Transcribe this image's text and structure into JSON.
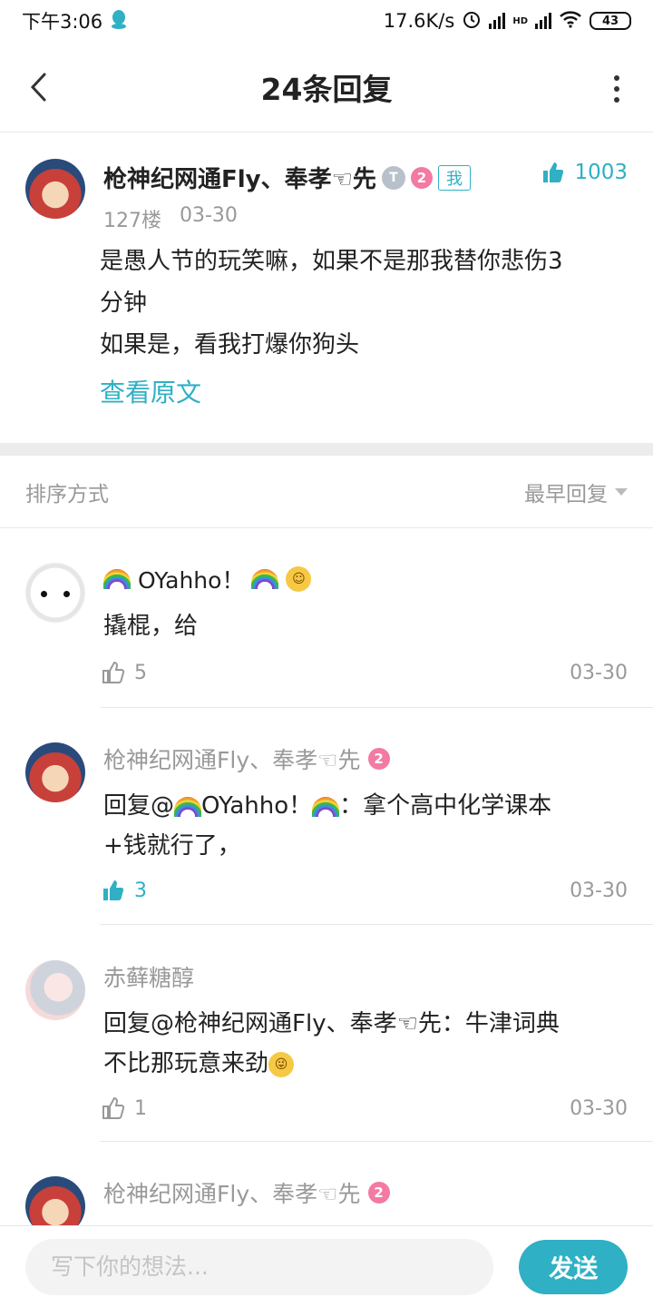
{
  "status_bar": {
    "time": "下午3:06",
    "net_speed": "17.6K/s",
    "network_label": "HD",
    "battery": "43"
  },
  "header": {
    "title": "24条回复"
  },
  "main_post": {
    "author": "枪神纪网通Fly、奉孝☜先",
    "t_badge": "T",
    "level": "2",
    "me_badge": "我",
    "likes": "1003",
    "floor": "127楼",
    "date": "03-30",
    "body_lines": [
      "是愚人节的玩笑嘛，如果不是那我替你悲伤3",
      "分钟",
      "如果是，看我打爆你狗头"
    ],
    "view_original": "查看原文"
  },
  "sort_bar": {
    "label": "排序方式",
    "selected": "最早回复"
  },
  "replies": [
    {
      "author": "OYahho！",
      "text": "撬棍，给",
      "likes": "5",
      "date": "03-30"
    },
    {
      "author": "枪神纪网通Fly、奉孝☜先",
      "level": "2",
      "reply_prefix": "回复@",
      "reply_target": "OYahho！",
      "text_line1": "：拿个高中化学课本",
      "text_line2": "+钱就行了，",
      "likes": "3",
      "date": "03-30"
    },
    {
      "author": "赤藓糖醇",
      "reply_prefix": "回复@",
      "reply_target": "枪神纪网通Fly、奉孝☜先",
      "text_line1": "：牛津词典",
      "text_line2": "不比那玩意来劲",
      "likes": "1",
      "date": "03-30"
    },
    {
      "author": "枪神纪网通Fly、奉孝☜先",
      "level": "2"
    }
  ],
  "composer": {
    "placeholder": "写下你的想法...",
    "send_label": "发送"
  },
  "colors": {
    "accent": "#2fb0c4",
    "level_badge": "#f27aa3"
  }
}
